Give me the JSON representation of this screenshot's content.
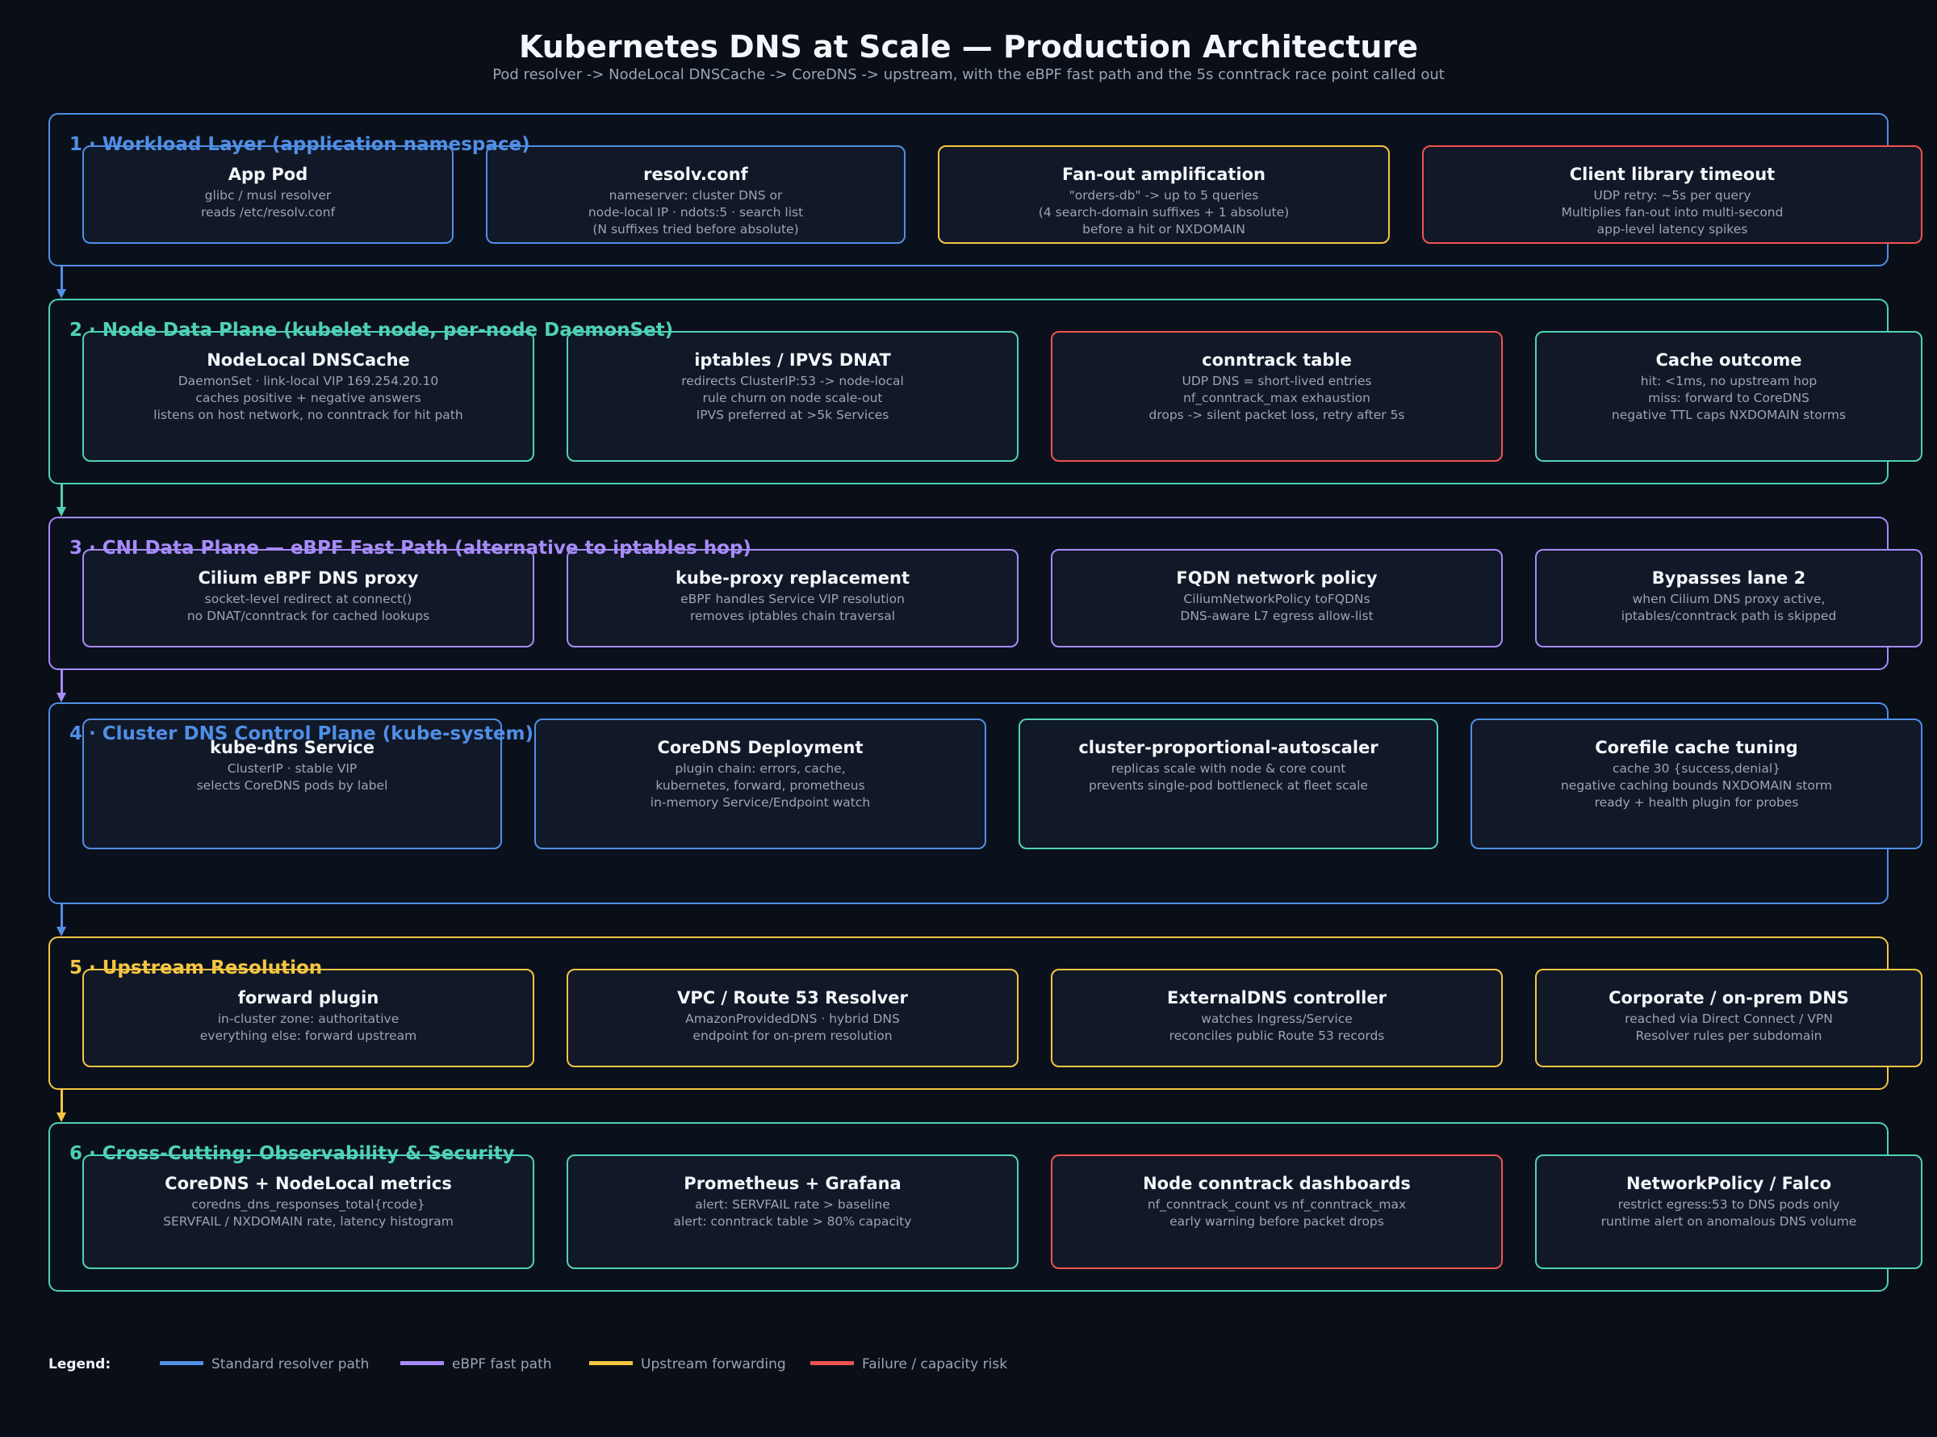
{
  "title": "Kubernetes DNS at Scale — Production Architecture",
  "subtitle": "Pod resolver -> NodeLocal DNSCache -> CoreDNS -> upstream, with the eBPF fast path and the 5s conntrack race point called out",
  "colors": {
    "blue": "#4f8fe6",
    "teal": "#4fd1b5",
    "purple": "#a78bfa",
    "yellow": "#f5c542",
    "red": "#ef5350"
  },
  "lanes": [
    {
      "title": "1 · Workload Layer (application namespace)",
      "color": "blue",
      "boxes": [
        {
          "title": "App Pod",
          "color": "blue",
          "lines": [
            "glibc / musl resolver",
            "reads /etc/resolv.conf"
          ]
        },
        {
          "title": "resolv.conf",
          "color": "blue",
          "lines": [
            "nameserver: cluster DNS or",
            "node-local IP · ndots:5 · search list",
            "(N suffixes tried before absolute)"
          ]
        },
        {
          "title": "Fan-out amplification",
          "color": "yellow",
          "lines": [
            "\"orders-db\" -> up to 5 queries",
            "(4 search-domain suffixes + 1 absolute)",
            "before a hit or NXDOMAIN"
          ]
        },
        {
          "title": "Client library timeout",
          "color": "red",
          "lines": [
            "UDP retry: ~5s per query",
            "Multiplies fan-out into multi-second",
            "app-level latency spikes"
          ]
        }
      ]
    },
    {
      "title": "2 · Node Data Plane (kubelet node, per-node DaemonSet)",
      "color": "teal",
      "boxes": [
        {
          "title": "NodeLocal DNSCache",
          "color": "teal",
          "lines": [
            "DaemonSet · link-local VIP 169.254.20.10",
            "caches positive + negative answers",
            "listens on host network, no conntrack for hit path"
          ]
        },
        {
          "title": "iptables / IPVS DNAT",
          "color": "teal",
          "lines": [
            "redirects ClusterIP:53 -> node-local",
            "rule churn on node scale-out",
            "IPVS preferred at >5k Services"
          ]
        },
        {
          "title": "conntrack table",
          "color": "red",
          "lines": [
            "UDP DNS = short-lived entries",
            "nf_conntrack_max exhaustion",
            "drops -> silent packet loss, retry after 5s"
          ]
        },
        {
          "title": "Cache outcome",
          "color": "teal",
          "lines": [
            "hit: <1ms, no upstream hop",
            "miss: forward to CoreDNS",
            "negative TTL caps NXDOMAIN storms"
          ]
        }
      ]
    },
    {
      "title": "3 · CNI Data Plane — eBPF Fast Path (alternative to iptables hop)",
      "color": "purple",
      "boxes": [
        {
          "title": "Cilium eBPF DNS proxy",
          "color": "purple",
          "lines": [
            "socket-level redirect at connect()",
            "no DNAT/conntrack for cached lookups"
          ]
        },
        {
          "title": "kube-proxy replacement",
          "color": "purple",
          "lines": [
            "eBPF handles Service VIP resolution",
            "removes iptables chain traversal"
          ]
        },
        {
          "title": "FQDN network policy",
          "color": "purple",
          "lines": [
            "CiliumNetworkPolicy toFQDNs",
            "DNS-aware L7 egress allow-list"
          ]
        },
        {
          "title": "Bypasses lane 2",
          "color": "purple",
          "lines": [
            "when Cilium DNS proxy active,",
            "iptables/conntrack path is skipped"
          ]
        }
      ]
    },
    {
      "title": "4 · Cluster DNS Control Plane (kube-system)",
      "color": "blue",
      "boxes": [
        {
          "title": "kube-dns Service",
          "color": "blue",
          "lines": [
            "ClusterIP · stable VIP",
            "selects CoreDNS pods by label"
          ]
        },
        {
          "title": "CoreDNS Deployment",
          "color": "blue",
          "lines": [
            "plugin chain: errors, cache,",
            "kubernetes, forward, prometheus",
            "in-memory Service/Endpoint watch"
          ]
        },
        {
          "title": "cluster-proportional-autoscaler",
          "color": "teal",
          "lines": [
            "replicas scale with node & core count",
            "prevents single-pod bottleneck at fleet scale"
          ]
        },
        {
          "title": "Corefile cache tuning",
          "color": "blue",
          "lines": [
            "cache 30 {success,denial}",
            "negative caching bounds NXDOMAIN storm",
            "ready + health plugin for probes"
          ]
        }
      ]
    },
    {
      "title": "5 · Upstream Resolution",
      "color": "yellow",
      "boxes": [
        {
          "title": "forward plugin",
          "color": "yellow",
          "lines": [
            "in-cluster zone: authoritative",
            "everything else: forward upstream"
          ]
        },
        {
          "title": "VPC / Route 53 Resolver",
          "color": "yellow",
          "lines": [
            "AmazonProvidedDNS · hybrid DNS",
            "endpoint for on-prem resolution"
          ]
        },
        {
          "title": "ExternalDNS controller",
          "color": "yellow",
          "lines": [
            "watches Ingress/Service",
            "reconciles public Route 53 records"
          ]
        },
        {
          "title": "Corporate / on-prem DNS",
          "color": "yellow",
          "lines": [
            "reached via Direct Connect / VPN",
            "Resolver rules per subdomain"
          ]
        }
      ]
    },
    {
      "title": "6 · Cross-Cutting: Observability & Security",
      "color": "teal",
      "boxes": [
        {
          "title": "CoreDNS + NodeLocal metrics",
          "color": "teal",
          "lines": [
            "coredns_dns_responses_total{rcode}",
            "SERVFAIL / NXDOMAIN rate, latency histogram"
          ]
        },
        {
          "title": "Prometheus + Grafana",
          "color": "teal",
          "lines": [
            "alert: SERVFAIL rate > baseline",
            "alert: conntrack table > 80% capacity"
          ]
        },
        {
          "title": "Node conntrack dashboards",
          "color": "red",
          "lines": [
            "nf_conntrack_count vs nf_conntrack_max",
            "early warning before packet drops"
          ]
        },
        {
          "title": "NetworkPolicy / Falco",
          "color": "teal",
          "lines": [
            "restrict egress:53 to DNS pods only",
            "runtime alert on anomalous DNS volume"
          ]
        }
      ]
    }
  ],
  "connector_colors": [
    "blue",
    "teal",
    "purple",
    "blue",
    "yellow"
  ],
  "legend": {
    "label": "Legend:",
    "items": [
      {
        "label": "Standard resolver path",
        "color": "blue"
      },
      {
        "label": "eBPF fast path",
        "color": "purple"
      },
      {
        "label": "Upstream forwarding",
        "color": "yellow"
      },
      {
        "label": "Failure / capacity risk",
        "color": "red"
      }
    ]
  }
}
